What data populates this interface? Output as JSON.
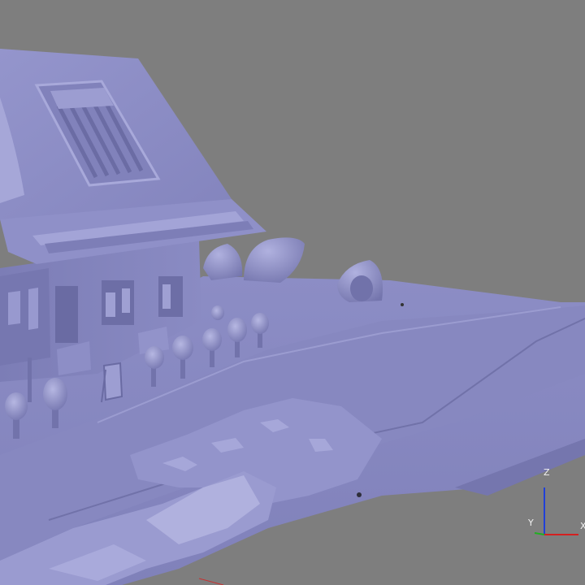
{
  "viewport": {
    "background_color": "#7e7e7e",
    "mesh_color": "#8b8cc4",
    "mesh_shadow_color": "#6e6fa6",
    "mesh_highlight_color": "#b3b4e0"
  },
  "axes": {
    "z_label": "Z",
    "y_label": "Y",
    "x_label": "X",
    "x_color": "#d42020",
    "y_color": "#20b020",
    "z_color": "#2040d8"
  }
}
